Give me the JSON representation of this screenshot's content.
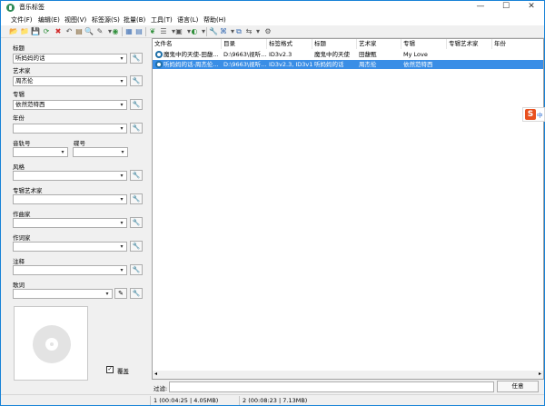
{
  "window": {
    "title": "音乐标签"
  },
  "menu": [
    "文件(F)",
    "编辑(E)",
    "视图(V)",
    "标签源(S)",
    "批量(B)",
    "工具(T)",
    "语言(L)",
    "帮助(H)"
  ],
  "window_controls": {
    "minimize": "—",
    "maximize": "☐",
    "close": "✕"
  },
  "toolbar": {
    "icons": [
      {
        "name": "open-folder-icon",
        "glyph": "📂"
      },
      {
        "name": "open-file-icon",
        "glyph": "📁"
      },
      {
        "name": "save-icon",
        "glyph": "💾"
      },
      {
        "name": "refresh-icon",
        "glyph": "⟳"
      },
      {
        "name": "delete-icon",
        "glyph": "✖"
      },
      {
        "name": "undo-icon",
        "glyph": "↶"
      },
      {
        "name": "book-icon",
        "glyph": "▤"
      },
      {
        "name": "search-icon",
        "glyph": "🔍"
      },
      {
        "name": "edit-icon",
        "glyph": "✎"
      },
      {
        "name": "globe-icon",
        "glyph": "◉"
      },
      {
        "name": "grid-icon",
        "glyph": "▦"
      },
      {
        "name": "list-icon",
        "glyph": "▤"
      },
      {
        "name": "leaf-icon",
        "glyph": "❦"
      },
      {
        "name": "playlist-icon",
        "glyph": "☰"
      },
      {
        "name": "image-icon",
        "glyph": "▣"
      },
      {
        "name": "source-icon",
        "glyph": "◐"
      },
      {
        "name": "wrench-icon",
        "glyph": "🔧"
      },
      {
        "name": "tag-icon",
        "glyph": "⌘"
      },
      {
        "name": "copy-icon",
        "glyph": "⧉"
      },
      {
        "name": "convert-icon",
        "glyph": "⇆"
      },
      {
        "name": "settings-icon",
        "glyph": "⚙"
      }
    ],
    "dropdown_glyph": "▾"
  },
  "fields": {
    "title": {
      "label": "标题",
      "value": "听妈妈的话"
    },
    "artist": {
      "label": "艺术家",
      "value": "周杰伦"
    },
    "album": {
      "label": "专辑",
      "value": "依然范特西"
    },
    "year": {
      "label": "年份",
      "value": ""
    },
    "track": {
      "label": "音轨号",
      "value": ""
    },
    "disc": {
      "label": "碟号",
      "value": ""
    },
    "genre": {
      "label": "风格",
      "value": ""
    },
    "album_artist": {
      "label": "专辑艺术家",
      "value": ""
    },
    "composer": {
      "label": "作曲家",
      "value": ""
    },
    "lyricist": {
      "label": "作词家",
      "value": ""
    },
    "comment": {
      "label": "注释",
      "value": ""
    },
    "lyrics": {
      "label": "歌词",
      "value": ""
    }
  },
  "cover": {
    "overwrite_label": "覆盖",
    "overwrite_checked": "✓"
  },
  "file_list": {
    "columns": [
      "文件名",
      "目录",
      "标签格式",
      "标题",
      "艺术家",
      "专辑",
      "专辑艺术家",
      "年份"
    ],
    "rows": [
      {
        "filename": "魔鬼中的天使-田馥...",
        "directory": "D:\\9663\\视听...",
        "tag_format": "ID3v2.3",
        "title": "魔鬼中的天使",
        "artist": "田馥甄",
        "album": "My Love",
        "album_artist": "",
        "year": ""
      },
      {
        "filename": "听妈妈的话-周杰伦...",
        "directory": "D:\\9663\\视听...",
        "tag_format": "ID3v2.3, ID3v1",
        "title": "听妈妈的话",
        "artist": "周杰伦",
        "album": "依然范特西",
        "album_artist": "",
        "year": ""
      }
    ],
    "selected_row": 1
  },
  "filter": {
    "label": "过滤:",
    "value": "",
    "button": "任意"
  },
  "status": {
    "selected": "1 (00:04:25 | 4.05MB)",
    "total": "2 (00:08:23 | 7.13MB)"
  },
  "ime": {
    "logo": "S",
    "lang": "中"
  },
  "colors": {
    "selection": "#3a8ee6",
    "window_border": "#1883d7"
  }
}
